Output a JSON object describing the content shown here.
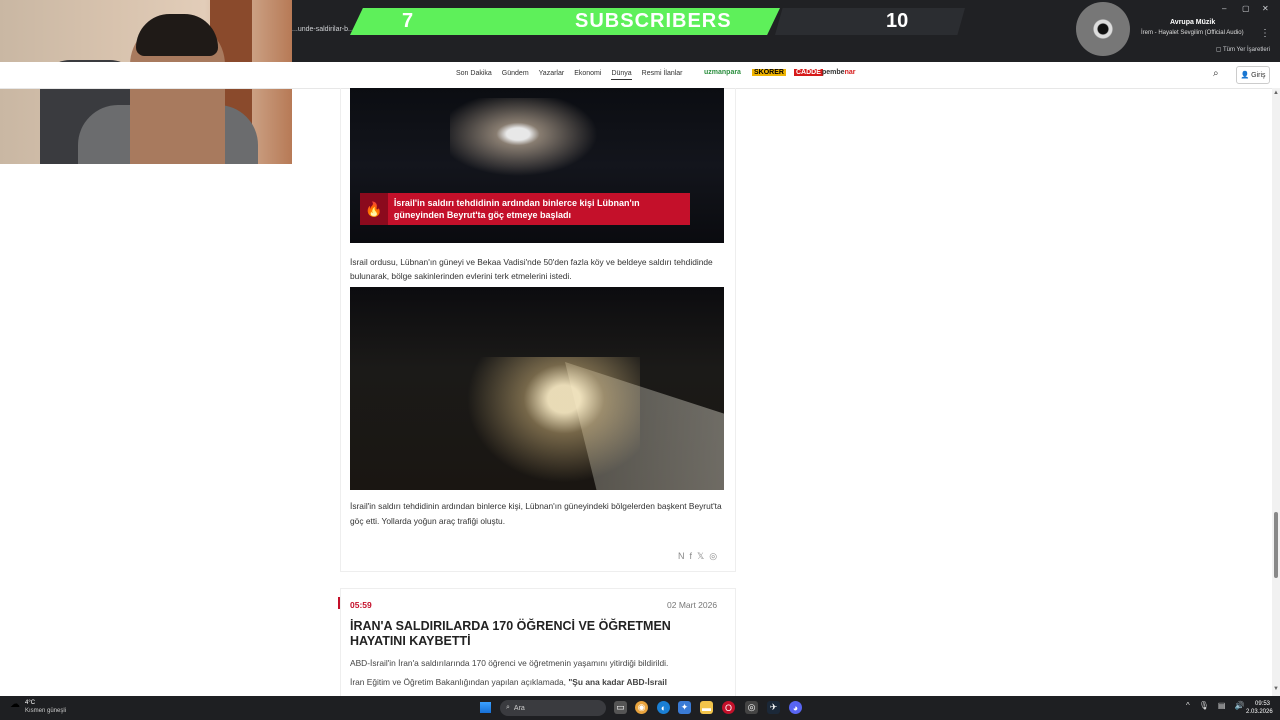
{
  "browser": {
    "url_fragment": "...unde-saldirilar-b...",
    "bookmarks_all": "Tüm Yer İşaretleri",
    "window_controls": [
      "–",
      "▢",
      "✕"
    ]
  },
  "overlay": {
    "subscriber_count": "7",
    "subscriber_label": "SUBSCRIBERS",
    "subscriber_goal": "10",
    "music_title": "Avrupa Müzik",
    "music_track": "İrem - Hayalet Sevgilim (Official Audio)"
  },
  "site": {
    "nav": [
      "Son Dakika",
      "Gündem",
      "Yazarlar",
      "Ekonomi",
      "Dünya",
      "Resmi İlanlar"
    ],
    "active_nav": "Dünya",
    "partners": {
      "p1": "uzmanpara",
      "p2": "SKORER",
      "p3": "CADDE",
      "p4a": "pembe",
      "p4b": "nar"
    },
    "login_label": "Giriş"
  },
  "article": {
    "image1_caption": "İsrail'in saldırı tehdidinin ardından binlerce kişi Lübnan'ın güneyinden Beyrut'ta göç etmeye başladı",
    "paragraph1": "İsrail ordusu, Lübnan'ın güneyi ve Bekaa Vadisi'nde 50'den fazla köy ve beldeye saldırı tehdidinde bulunarak, bölge sakinlerinden evlerini terk etmelerini istedi.",
    "paragraph2": "İsrail'in saldırı tehdidinin ardından binlerce kişi, Lübnan'ın güneyindeki bölgelerden başkent Beyrut'ta göç etti. Yollarda yoğun araç trafiği oluştu.",
    "share_icons": [
      "N",
      "f",
      "𝕏",
      "◎"
    ]
  },
  "next_item": {
    "time": "05:59",
    "date": "02 Mart 2026",
    "headline": "İRAN'A SALDIRILARDA 170 ÖĞRENCİ VE ÖĞRETMEN HAYATINI KAYBETTİ",
    "p1": "ABD-İsrail'in İran'a saldırılarında 170 öğrenci ve öğretmenin yaşamını yitirdiği bildirildi.",
    "p2_normal": "İran Eğitim ve Öğretim Bakanlığından yapılan açıklamada, ",
    "p2_bold": "\"Şu ana kadar ABD-İsrail"
  },
  "taskbar": {
    "weather_temp": "4°C",
    "weather_desc": "Kısmen güneşli",
    "search_placeholder": "Ara",
    "time": "09:53",
    "date": "2.03.2026"
  },
  "colors": {
    "accent_red": "#c4102a",
    "subscriber_green": "#5ef05a"
  }
}
